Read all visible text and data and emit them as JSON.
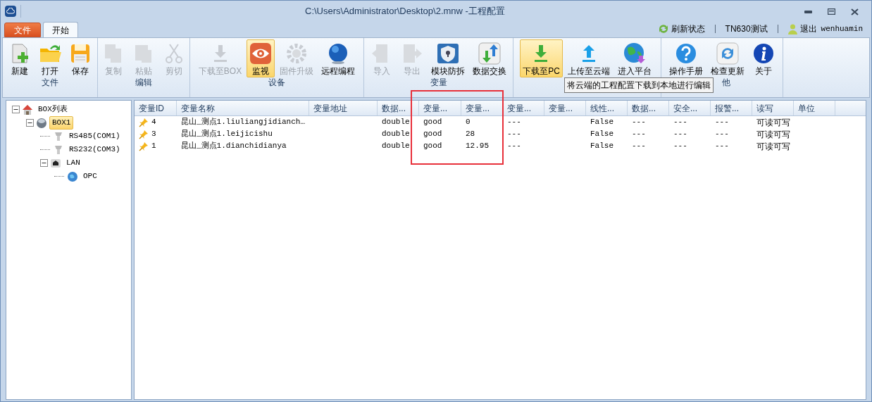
{
  "window": {
    "title": "C:\\Users\\Administrator\\Desktop\\2.mnw -工程配置"
  },
  "tabs": [
    {
      "label": "文件",
      "kind": "file",
      "selected": false
    },
    {
      "label": "开始",
      "kind": "tab",
      "selected": true
    }
  ],
  "account": {
    "refresh": "刷新状态",
    "project": "TN630测试",
    "logout": "退出",
    "user": "wenhuamin"
  },
  "ribbon": [
    {
      "label": "文件",
      "items": [
        {
          "label": "新建",
          "disabled": false,
          "selected": false
        },
        {
          "label": "打开",
          "disabled": false,
          "selected": false
        },
        {
          "label": "保存",
          "disabled": false,
          "selected": false
        }
      ]
    },
    {
      "label": "编辑",
      "items": [
        {
          "label": "复制",
          "disabled": true,
          "selected": false
        },
        {
          "label": "粘贴",
          "disabled": true,
          "selected": false
        },
        {
          "label": "剪切",
          "disabled": true,
          "selected": false
        }
      ]
    },
    {
      "label": "设备",
      "items": [
        {
          "label": "下载至BOX",
          "disabled": true,
          "selected": false
        },
        {
          "label": "监视",
          "disabled": false,
          "selected": true
        },
        {
          "label": "固件升级",
          "disabled": true,
          "selected": false
        },
        {
          "label": "远程编程",
          "disabled": false,
          "selected": false
        }
      ]
    },
    {
      "label": "变量",
      "items": [
        {
          "label": "导入",
          "disabled": true,
          "selected": false
        },
        {
          "label": "导出",
          "disabled": true,
          "selected": false
        },
        {
          "label": "模块防拆",
          "disabled": false,
          "selected": false
        },
        {
          "label": "数据交换",
          "disabled": false,
          "selected": false
        }
      ]
    },
    {
      "items": [
        {
          "label": "下载至PC",
          "disabled": false,
          "selected": true
        },
        {
          "label": "上传至云端",
          "disabled": false,
          "selected": false
        },
        {
          "label": "进入平台",
          "disabled": false,
          "selected": false
        }
      ]
    },
    {
      "label": "他",
      "items": [
        {
          "label": "操作手册",
          "disabled": false,
          "selected": false
        },
        {
          "label": "检查更新",
          "disabled": false,
          "selected": false
        },
        {
          "label": "关于",
          "disabled": false,
          "selected": false
        }
      ]
    }
  ],
  "tooltip": "将云端的工程配置下载到本地进行编辑",
  "tree": [
    {
      "label": "BOX列表",
      "expanded": true,
      "selected": false,
      "children": [
        {
          "label": "BOX1",
          "expanded": true,
          "selected": true,
          "children": [
            {
              "label": "RS485(COM1)",
              "selected": false
            },
            {
              "label": "RS232(COM3)",
              "selected": false
            },
            {
              "label": "LAN",
              "expanded": true,
              "selected": false,
              "children": [
                {
                  "label": "OPC",
                  "selected": false
                }
              ]
            }
          ]
        }
      ]
    }
  ],
  "table": {
    "columns": [
      "变量ID",
      "变量名称",
      "变量地址",
      "数据...",
      "变量...",
      "变量...",
      "变量...",
      "变量...",
      "线性...",
      "数据...",
      "安全...",
      "报警...",
      "读写",
      "单位"
    ],
    "rows": [
      [
        "4",
        "昆山_测点1.liuliangjidianch…",
        null,
        "double",
        "good",
        "0",
        "---",
        null,
        "False",
        "---",
        "---",
        "---",
        "可读可写",
        null
      ],
      [
        "3",
        "昆山_测点1.leijicishu",
        null,
        "double",
        "good",
        "28",
        "---",
        null,
        "False",
        "---",
        "---",
        "---",
        "可读可写",
        null
      ],
      [
        "1",
        "昆山_测点1.dianchidianya",
        null,
        "double",
        "good",
        "12.95",
        "---",
        null,
        "False",
        "---",
        "---",
        "---",
        "可读可写",
        null
      ]
    ]
  }
}
